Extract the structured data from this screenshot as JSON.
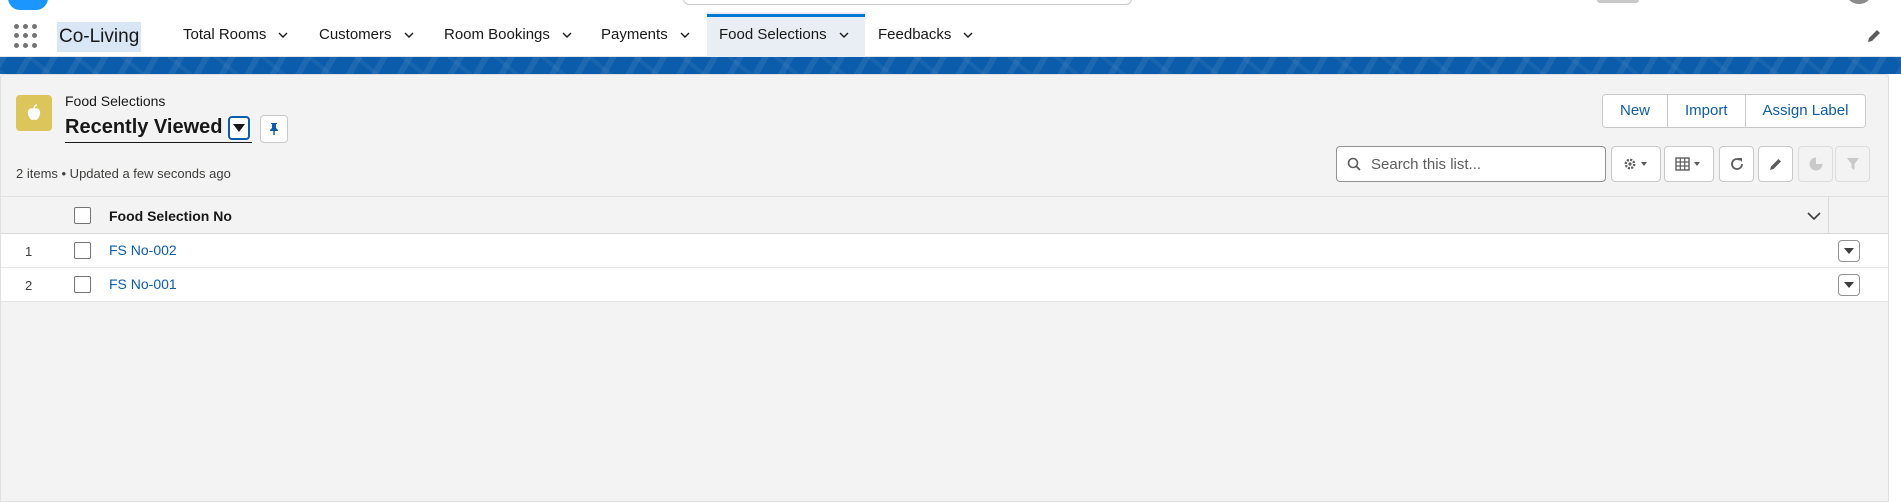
{
  "app": {
    "name": "Co-Living"
  },
  "nav": {
    "tabs": [
      {
        "label": "Total Rooms",
        "active": false
      },
      {
        "label": "Customers",
        "active": false
      },
      {
        "label": "Room Bookings",
        "active": false
      },
      {
        "label": "Payments",
        "active": false
      },
      {
        "label": "Food Selections",
        "active": true
      },
      {
        "label": "Feedbacks",
        "active": false
      }
    ]
  },
  "header": {
    "object_label": "Food Selections",
    "list_view_name": "Recently Viewed",
    "status": "2 items • Updated a few seconds ago"
  },
  "actions": {
    "new_label": "New",
    "import_label": "Import",
    "assign_label": "Assign Label"
  },
  "search": {
    "placeholder": "Search this list...",
    "value": ""
  },
  "table": {
    "columns": [
      "Food Selection No"
    ],
    "rows": [
      {
        "num": "1",
        "name": "FS No-002"
      },
      {
        "num": "2",
        "name": "FS No-001"
      }
    ]
  },
  "colors": {
    "brand": "#0176d3",
    "link": "#0b5cab",
    "object_icon": "#dcc55b",
    "band": "#0b5cab"
  },
  "icons": [
    "app-launcher-icon",
    "chevron-down-icon",
    "pencil-icon",
    "apple-icon",
    "caret-down-icon",
    "pin-icon",
    "search-icon",
    "gear-icon",
    "table-icon",
    "refresh-icon",
    "chart-icon",
    "filter-icon"
  ]
}
